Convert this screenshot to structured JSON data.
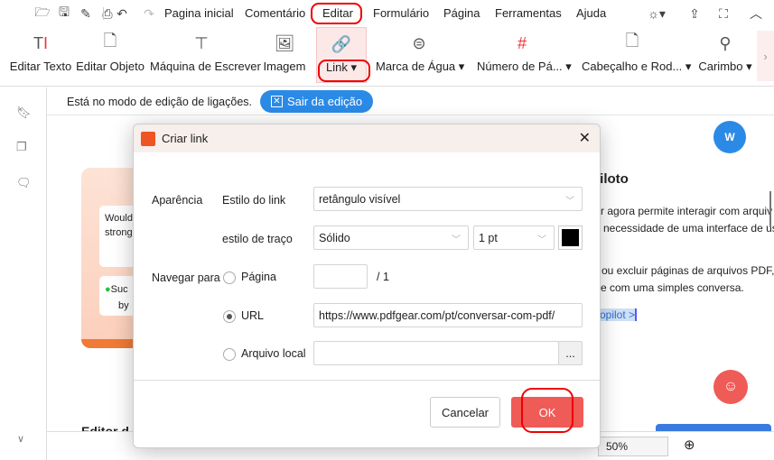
{
  "menu": {
    "items": [
      "Pagina inicial",
      "Comentário",
      "Editar",
      "Formulário",
      "Página",
      "Ferramentas",
      "Ajuda"
    ]
  },
  "ribbon": {
    "tools": [
      "Editar Texto",
      "Editar Objeto",
      "Máquina de Escrever",
      "Imagem",
      "Link",
      "Marca de Água",
      "Número de Pá...",
      "Cabeçalho e Rod...",
      "Carimbo"
    ]
  },
  "modebar": {
    "message": "Está no modo de edição de ligações.",
    "exit_label": "Sair da edição"
  },
  "document": {
    "heading": "piloto",
    "line1": "r agora permite interagir com arquiv",
    "line2": "necessidade de uma interface de us",
    "line3": "ou excluir páginas de arquivos PDF,",
    "line4": "e com uma simples conversa.",
    "link": "opilot >",
    "card1a": "Would",
    "card1b": "strong",
    "card2a": "Suc",
    "card2b": "by",
    "bottom_heading": "Editor d"
  },
  "dialog": {
    "title": "Criar link",
    "appearance_label": "Aparência",
    "link_style_label": "Estilo do link",
    "link_style_value": "retângulo visível",
    "stroke_style_label": "estilo de traço",
    "stroke_style_value": "Sólido",
    "stroke_width_value": "1 pt",
    "stroke_color": "#000000",
    "navigate_label": "Navegar para",
    "page_option": "Página",
    "page_value": "",
    "page_total": "/ 1",
    "url_option": "URL",
    "url_value": "https://www.pdfgear.com/pt/conversar-com-pdf/",
    "local_file_option": "Arquivo local",
    "local_file_value": "",
    "browse_label": "...",
    "cancel_label": "Cancelar",
    "ok_label": "OK",
    "selected_option": "URL"
  },
  "statusbar": {
    "zoom": "50%"
  },
  "colors": {
    "accent": "#2b8ae6",
    "ok": "#ef5b57",
    "highlight": "#e00000"
  }
}
